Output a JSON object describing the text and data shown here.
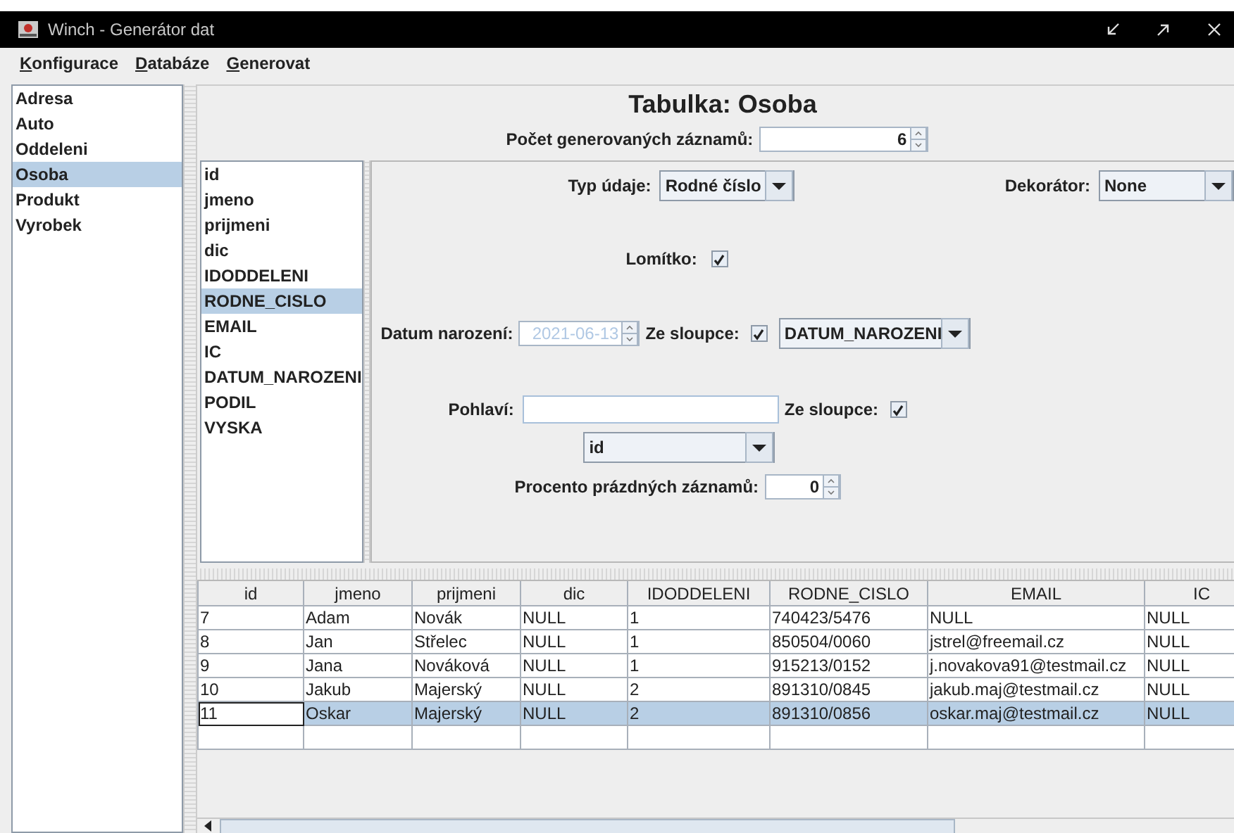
{
  "window": {
    "title": "Winch - Generátor dat"
  },
  "menu": [
    "Konfigurace",
    "Databáze",
    "Generovat"
  ],
  "tables": [
    {
      "label": "Adresa",
      "selected": false
    },
    {
      "label": "Auto",
      "selected": false
    },
    {
      "label": "Oddeleni",
      "selected": false
    },
    {
      "label": "Osoba",
      "selected": true
    },
    {
      "label": "Produkt",
      "selected": false
    },
    {
      "label": "Vyrobek",
      "selected": false
    }
  ],
  "heading": "Tabulka: Osoba",
  "count": {
    "label": "Počet generovaných záznamů:",
    "value": "6"
  },
  "columns": [
    {
      "label": "id",
      "selected": false
    },
    {
      "label": "jmeno",
      "selected": false
    },
    {
      "label": "prijmeni",
      "selected": false
    },
    {
      "label": "dic",
      "selected": false
    },
    {
      "label": "IDODDELENI",
      "selected": false
    },
    {
      "label": "RODNE_CISLO",
      "selected": true
    },
    {
      "label": "EMAIL",
      "selected": false
    },
    {
      "label": "IC",
      "selected": false
    },
    {
      "label": "DATUM_NAROZENI",
      "selected": false
    },
    {
      "label": "PODIL",
      "selected": false
    },
    {
      "label": "VYSKA",
      "selected": false
    }
  ],
  "settings": {
    "data_type": {
      "label": "Typ údaje:",
      "value": "Rodné číslo"
    },
    "decorator": {
      "label": "Dekorátor:",
      "value": "None"
    },
    "slash": {
      "label": "Lomítko:",
      "checked": true
    },
    "birth_date": {
      "label": "Datum narození:",
      "value": "2021-06-13",
      "disabled": true,
      "from_column_label": "Ze sloupce:",
      "from_column_checked": true,
      "column": "DATUM_NAROZENI"
    },
    "gender": {
      "label": "Pohlaví:",
      "from_column_label": "Ze sloupce:",
      "from_column_checked": true,
      "column": "id"
    },
    "empty_percent": {
      "label": "Procento prázdných záznamů:",
      "value": "0"
    }
  },
  "table": {
    "columns": [
      "id",
      "jmeno",
      "prijmeni",
      "dic",
      "IDODDELENI",
      "RODNE_CISLO",
      "EMAIL",
      "IC"
    ],
    "rows": [
      {
        "cells": [
          "7",
          "Adam",
          "Novák",
          "NULL",
          "1",
          "740423/5476",
          "NULL",
          "NULL"
        ],
        "selected": false
      },
      {
        "cells": [
          "8",
          "Jan",
          "Střelec",
          "NULL",
          "1",
          "850504/0060",
          "jstrel@freemail.cz",
          "NULL"
        ],
        "selected": false
      },
      {
        "cells": [
          "9",
          "Jana",
          "Nováková",
          "NULL",
          "1",
          "915213/0152",
          "j.novakova91@testmail.cz",
          "NULL"
        ],
        "selected": false
      },
      {
        "cells": [
          "10",
          "Jakub",
          "Majerský",
          "NULL",
          "2",
          "891310/0845",
          "jakub.maj@testmail.cz",
          "NULL"
        ],
        "selected": false
      },
      {
        "cells": [
          "11",
          "Oskar",
          "Majerský",
          "NULL",
          "2",
          "891310/0856",
          "oskar.maj@testmail.cz",
          "NULL"
        ],
        "selected": true
      },
      {
        "cells": [],
        "selected": false
      }
    ]
  }
}
